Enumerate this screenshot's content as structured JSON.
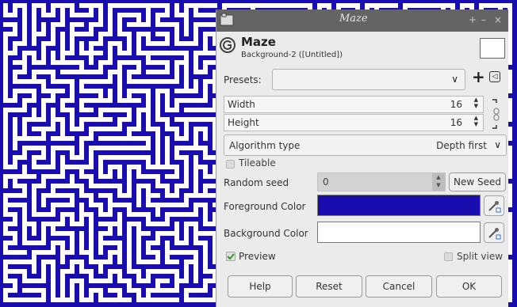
{
  "window": {
    "title": "Maze",
    "controls": [
      "+",
      "–",
      "×"
    ]
  },
  "header": {
    "plugin_name": "Maze",
    "subtitle": "Background-2 ([Untitled])"
  },
  "presets": {
    "label": "Presets:",
    "value": "",
    "add_symbol": "+",
    "menu_symbol": "◁"
  },
  "width": {
    "label": "Width",
    "value": "16"
  },
  "height": {
    "label": "Height",
    "value": "16"
  },
  "algorithm": {
    "label": "Algorithm type",
    "value": "Depth first"
  },
  "tileable": {
    "label": "Tileable",
    "checked": false
  },
  "random_seed": {
    "label": "Random seed",
    "value": "0",
    "new_seed_label": "New Seed"
  },
  "foreground": {
    "label": "Foreground Color",
    "color": "#1a0db0"
  },
  "background": {
    "label": "Background Color",
    "color": "#ffffff"
  },
  "preview": {
    "label": "Preview",
    "checked": true
  },
  "split_view": {
    "label": "Split view",
    "checked": false
  },
  "buttons": {
    "help": "Help",
    "reset": "Reset",
    "cancel": "Cancel",
    "ok": "OK"
  },
  "icons": [
    "gimp-icon",
    "chain-link-icon",
    "eyedropper-icon",
    "preset-menu-icon"
  ],
  "colors": {
    "maze_wall": "#1a0db0",
    "maze_path": "#ffffff"
  }
}
